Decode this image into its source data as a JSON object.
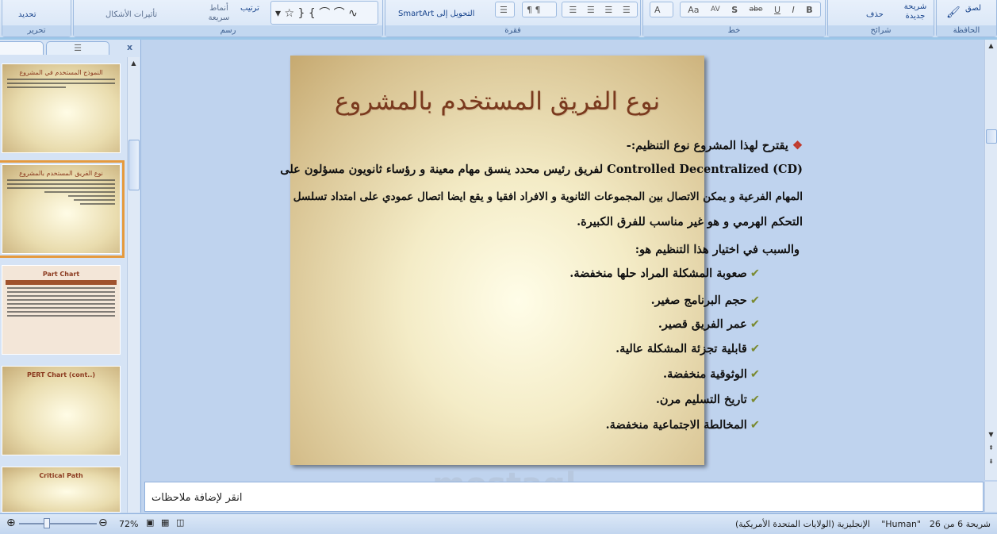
{
  "ribbon": {
    "groups": {
      "clipboard": "الحافظة",
      "slides": "شرائح",
      "font": "خط",
      "paragraph": "فقرة",
      "drawing": "رسم",
      "editing": "تحرير"
    },
    "paste": "لصق",
    "new_slide": "شريحة جديدة",
    "delete": "حذف",
    "convert_smartart": "التحويل إلى SmartArt",
    "arrange": "ترتيب",
    "quick_styles": "أنماط سريعة",
    "shape_effects": "تأثيرات الأشكال",
    "select": "تحديد",
    "font_buttons": [
      "B",
      "I",
      "U",
      "abe",
      "S",
      "AV",
      "Aa",
      "A"
    ]
  },
  "pane": {
    "close": "x"
  },
  "thumbnails": [
    {
      "title": "النموذج المستخدم في المشروع"
    },
    {
      "title": "نوع الفريق المستخدم بالمشروع",
      "selected": true
    },
    {
      "title": "Part Chart"
    },
    {
      "title": "PERT Chart (cont..)"
    },
    {
      "title": "Critical Path"
    }
  ],
  "slide": {
    "title": "نوع الفريق المستخدم بالمشروع",
    "bullet": "يقترح لهذا المشروع نوع التنظيم:-",
    "para": [
      "Controlled Decentralized (CD) لفريق رئيس محدد ينسق مهام معينة و رؤساء ثانويون مسؤلون على",
      "المهام الفرعية و يمكن الاتصال بين المجموعات الثانوية و الافراد افقيا و يقع ايضا اتصال عمودي على امتداد تسلسل",
      "التحكم الهرمي و هو غير مناسب للفرق الكبيرة."
    ],
    "reason": "والسبب في اختيار هذا التنظيم هو:",
    "checks": [
      "صعوبة المشكلة المراد حلها منخفضة.",
      "حجم البرنامج صغير.",
      "عمر الفريق قصير.",
      "قابلية تجزئة المشكلة عالية.",
      "الوثوقية منخفضة.",
      "تاريخ التسليم مرن.",
      "المخالطة الاجتماعية منخفضة."
    ],
    "colors": {
      "title": "#7a3a1e",
      "bullet": "#c0392b",
      "check": "#7a8a30"
    }
  },
  "notes": {
    "placeholder": "انقر لإضافة ملاحظات"
  },
  "status": {
    "slide": "شريحة 6 من 26",
    "theme": "\"Human\"",
    "language": "الإنجليزية (الولايات المتحدة الأمريكية)",
    "zoom": "72%",
    "zoom_level": 72
  },
  "watermark": "مستقل mostaql.com"
}
